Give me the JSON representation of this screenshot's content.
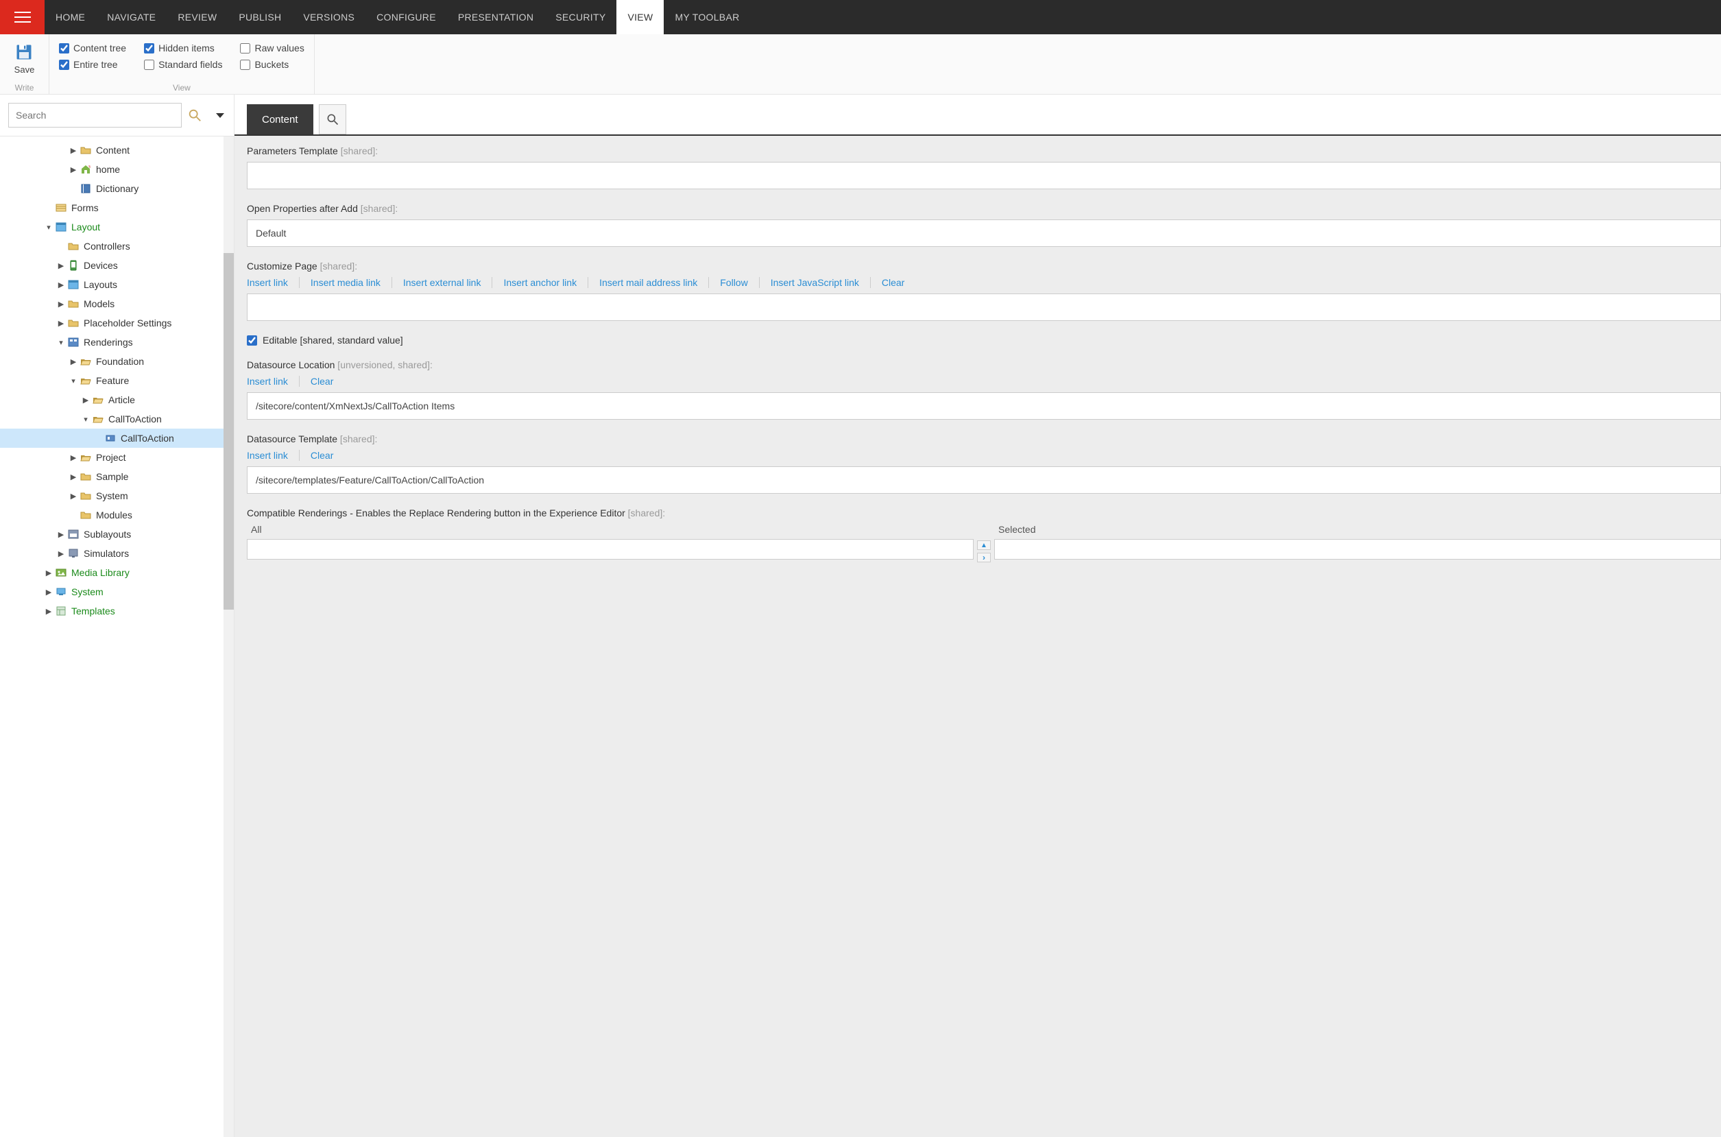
{
  "topTabs": [
    "HOME",
    "NAVIGATE",
    "REVIEW",
    "PUBLISH",
    "VERSIONS",
    "CONFIGURE",
    "PRESENTATION",
    "SECURITY",
    "VIEW",
    "MY TOOLBAR"
  ],
  "activeTopTab": "VIEW",
  "ribbon": {
    "saveLabel": "Save",
    "saveGroup": "Write",
    "viewGroup": "View",
    "checks": {
      "contentTree": "Content tree",
      "entireTree": "Entire tree",
      "hiddenItems": "Hidden items",
      "standardFields": "Standard fields",
      "rawValues": "Raw values",
      "buckets": "Buckets"
    }
  },
  "search": {
    "placeholder": "Search"
  },
  "tree": [
    {
      "depth": 3,
      "twisty": "▶",
      "icon": "folder",
      "label": "Content"
    },
    {
      "depth": 3,
      "twisty": "▶",
      "icon": "home",
      "label": "home"
    },
    {
      "depth": 3,
      "twisty": "",
      "icon": "book",
      "label": "Dictionary"
    },
    {
      "depth": 1,
      "twisty": "",
      "icon": "forms",
      "label": "Forms"
    },
    {
      "depth": 1,
      "twisty": "▾",
      "icon": "layout",
      "label": "Layout",
      "green": true
    },
    {
      "depth": 2,
      "twisty": "",
      "icon": "folder",
      "label": "Controllers"
    },
    {
      "depth": 2,
      "twisty": "▶",
      "icon": "device",
      "label": "Devices"
    },
    {
      "depth": 2,
      "twisty": "▶",
      "icon": "layout",
      "label": "Layouts"
    },
    {
      "depth": 2,
      "twisty": "▶",
      "icon": "folder",
      "label": "Models"
    },
    {
      "depth": 2,
      "twisty": "▶",
      "icon": "folder",
      "label": "Placeholder Settings"
    },
    {
      "depth": 2,
      "twisty": "▾",
      "icon": "rendering",
      "label": "Renderings"
    },
    {
      "depth": 3,
      "twisty": "▶",
      "icon": "folder-open",
      "label": "Foundation"
    },
    {
      "depth": 3,
      "twisty": "▾",
      "icon": "folder-open",
      "label": "Feature"
    },
    {
      "depth": 4,
      "twisty": "▶",
      "icon": "folder-open",
      "label": "Article"
    },
    {
      "depth": 4,
      "twisty": "▾",
      "icon": "folder-open",
      "label": "CallToAction"
    },
    {
      "depth": 5,
      "twisty": "",
      "icon": "component",
      "label": "CallToAction",
      "selected": true
    },
    {
      "depth": 3,
      "twisty": "▶",
      "icon": "folder-open",
      "label": "Project"
    },
    {
      "depth": 3,
      "twisty": "▶",
      "icon": "folder",
      "label": "Sample"
    },
    {
      "depth": 3,
      "twisty": "▶",
      "icon": "folder",
      "label": "System"
    },
    {
      "depth": 3,
      "twisty": "",
      "icon": "folder",
      "label": "Modules"
    },
    {
      "depth": 2,
      "twisty": "▶",
      "icon": "sublayout",
      "label": "Sublayouts"
    },
    {
      "depth": 2,
      "twisty": "▶",
      "icon": "simulator",
      "label": "Simulators"
    },
    {
      "depth": 1,
      "twisty": "▶",
      "icon": "media",
      "label": "Media Library",
      "green": true
    },
    {
      "depth": 1,
      "twisty": "▶",
      "icon": "system",
      "label": "System",
      "green": true
    },
    {
      "depth": 1,
      "twisty": "▶",
      "icon": "template",
      "label": "Templates",
      "green": true
    }
  ],
  "contentTab": "Content",
  "fields": {
    "paramsTemplate": {
      "label": "Parameters Template",
      "hint": " [shared]:",
      "value": ""
    },
    "openProps": {
      "label": "Open Properties after Add",
      "hint": " [shared]:",
      "value": "Default"
    },
    "customizePage": {
      "label": "Customize Page",
      "hint": " [shared]:",
      "value": "",
      "links": [
        "Insert link",
        "Insert media link",
        "Insert external link",
        "Insert anchor link",
        "Insert mail address link",
        "Follow",
        "Insert JavaScript link",
        "Clear"
      ]
    },
    "editable": {
      "label": "Editable",
      "hint": " [shared, standard value]",
      "checked": true
    },
    "dsLocation": {
      "label": "Datasource Location",
      "hint": " [unversioned, shared]:",
      "value": "/sitecore/content/XmNextJs/CallToAction Items",
      "links": [
        "Insert link",
        "Clear"
      ]
    },
    "dsTemplate": {
      "label": "Datasource Template",
      "hint": " [shared]:",
      "value": "/sitecore/templates/Feature/CallToAction/CallToAction",
      "links": [
        "Insert link",
        "Clear"
      ]
    },
    "compat": {
      "label": "Compatible Renderings - Enables the Replace Rendering button in the Experience Editor",
      "hint": " [shared]:",
      "allLabel": "All",
      "selLabel": "Selected"
    }
  }
}
